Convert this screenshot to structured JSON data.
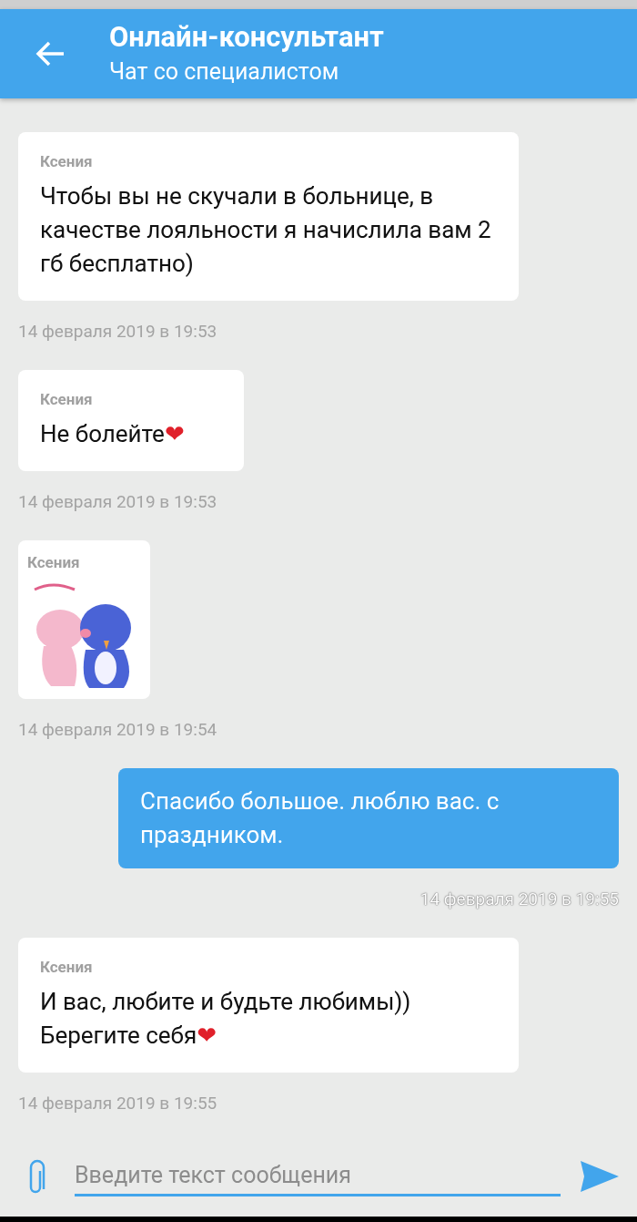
{
  "header": {
    "title": "Онлайн-консультант",
    "subtitle": "Чат со специалистом"
  },
  "messages": [
    {
      "kind": "incoming",
      "author": "Ксения",
      "text": "Чтобы вы не скучали в больнице, в качестве лояльности я начислила вам 2 гб бесплатно)",
      "time": "14 февраля 2019 в 19:53"
    },
    {
      "kind": "incoming",
      "author": "Ксения",
      "text": "Не болейте❤",
      "time": "14 февраля 2019 в 19:53"
    },
    {
      "kind": "sticker",
      "author": "Ксения",
      "time": "14 февраля 2019 в 19:54"
    },
    {
      "kind": "outgoing",
      "text": "Спасибо большое. люблю вас. с праздником.",
      "time": "14 февраля 2019 в 19:55"
    },
    {
      "kind": "incoming",
      "author": "Ксения",
      "text": "И вас, любите и будьте любимы))\nБерегите себя❤",
      "time": "14 февраля 2019 в 19:55"
    }
  ],
  "composer": {
    "placeholder": "Введите текст сообщения"
  }
}
